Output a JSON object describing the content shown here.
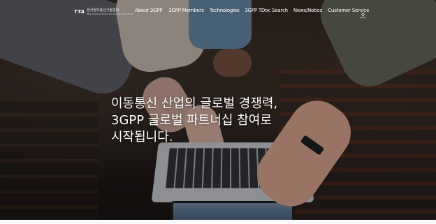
{
  "header": {
    "logo": {
      "mark": "TTA",
      "org_name": "한국정보통신기술협회",
      "org_name_en": "Telecommunications Technology Association"
    },
    "nav": [
      {
        "label": "About 3GPP",
        "name": "nav-about-3gpp"
      },
      {
        "label": "3GPP Members",
        "name": "nav-3gpp-members"
      },
      {
        "label": "Technologies",
        "name": "nav-technologies"
      },
      {
        "label": "3GPP TDoc Search",
        "name": "nav-tdoc-search"
      },
      {
        "label": "News/Notice",
        "name": "nav-news-notice"
      },
      {
        "label": "Customer Service",
        "name": "nav-customer-service"
      }
    ],
    "user_icon": "user-icon"
  },
  "hero": {
    "headline_lines": [
      "이동통신 산업의 글로벌 경쟁력,",
      "3GPP 글로벌 파트너십 참여로",
      "시작됩니다."
    ]
  },
  "colors": {
    "text": "#ffffff",
    "overlay": "#0a0807"
  }
}
